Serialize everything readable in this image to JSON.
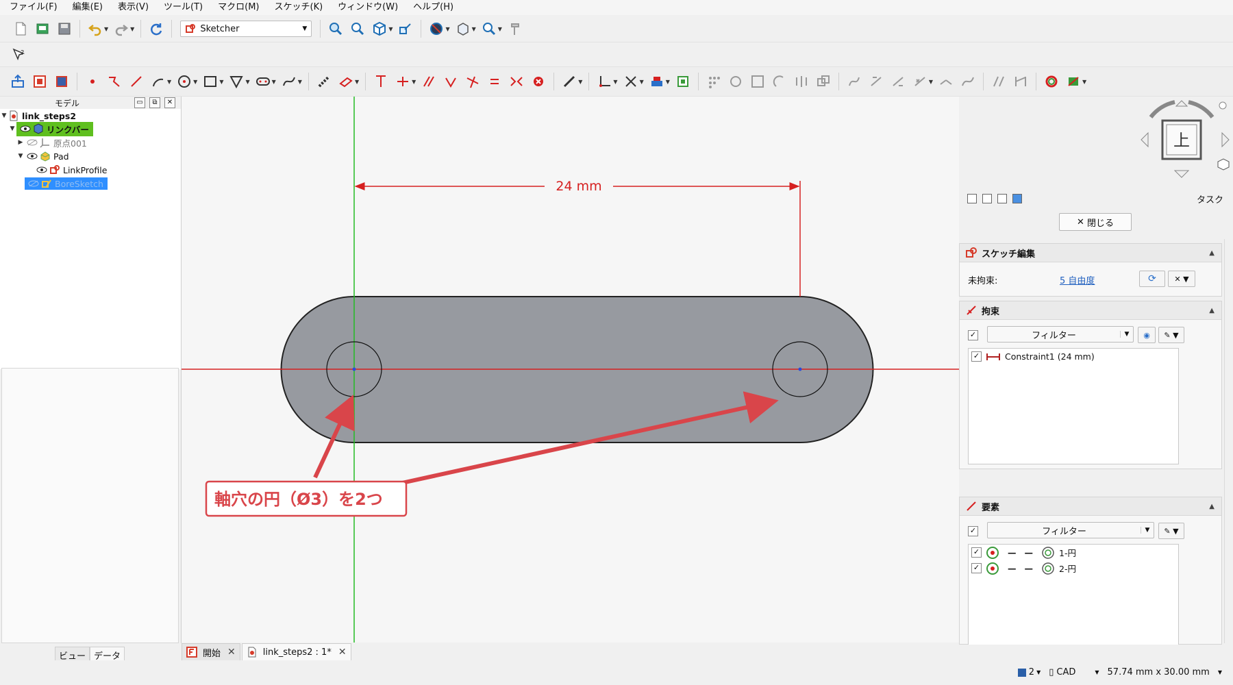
{
  "menu": [
    "ファイル(F)",
    "編集(E)",
    "表示(V)",
    "ツール(T)",
    "マクロ(M)",
    "スケッチ(K)",
    "ウィンドウ(W)",
    "ヘルプ(H)"
  ],
  "workbench": {
    "selected": "Sketcher"
  },
  "model_panel": {
    "title": "モデル",
    "tree": {
      "root": "link_steps2",
      "body": "リンクバー",
      "origin": "原点001",
      "pad": "Pad",
      "link_profile": "LinkProfile",
      "bore_sketch": "BoreSketch"
    },
    "tabs": {
      "view": "ビュー",
      "data": "データ"
    }
  },
  "canvas": {
    "dimension_label": "24 mm",
    "annotation": "軸穴の円（Ø3）を2つ",
    "colors": {
      "axis_x": "#d62020",
      "axis_y": "#22bb22",
      "body": "#979aa0",
      "annotation": "#d9454a"
    }
  },
  "navcube": {
    "face": "上"
  },
  "task_panel": {
    "label": "タスク",
    "close_button": "閉じる",
    "sketch_edit": {
      "title": "スケッチ編集",
      "unconstrained_label": "未拘束:",
      "dof_link": "5 自由度"
    },
    "constraints": {
      "title": "拘束",
      "filter": "フィルター",
      "items": [
        "Constraint1 (24 mm)"
      ]
    },
    "elements": {
      "title": "要素",
      "filter": "フィルター",
      "items": [
        "1-円",
        "2-円"
      ]
    }
  },
  "document_tabs": [
    {
      "label": "開始",
      "active": false
    },
    {
      "label": "link_steps2 : 1*",
      "active": true
    }
  ],
  "status_bar": {
    "page": "2",
    "nav_style": "CAD",
    "dimensions": "57.74 mm x 30.00 mm"
  }
}
